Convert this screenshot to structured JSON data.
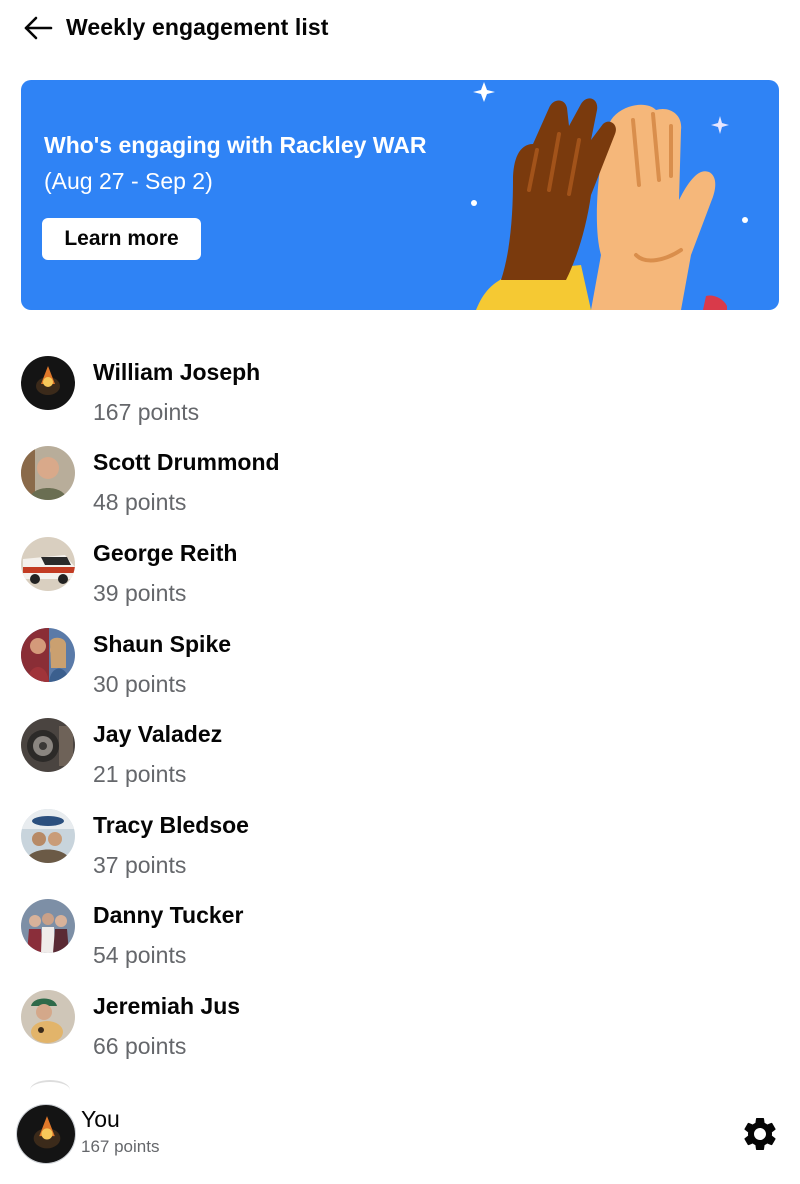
{
  "header": {
    "title": "Weekly engagement list",
    "back_icon": "arrow-left-icon"
  },
  "banner": {
    "title": "Who's engaging with Rackley WAR",
    "date_range": "(Aug 27 - Sep 2)",
    "learn_more_label": "Learn more",
    "background_color": "#2f83f5",
    "art": "high-five-hands-illustration"
  },
  "list": {
    "items": [
      {
        "name": "William Joseph",
        "points": "167 points"
      },
      {
        "name": "Scott Drummond",
        "points": "48 points"
      },
      {
        "name": "George Reith",
        "points": "39 points"
      },
      {
        "name": "Shaun Spike",
        "points": "30 points"
      },
      {
        "name": "Jay Valadez",
        "points": "21 points"
      },
      {
        "name": "Tracy Bledsoe",
        "points": "37 points"
      },
      {
        "name": "Danny Tucker",
        "points": "54 points"
      },
      {
        "name": "Jeremiah Jus",
        "points": "66 points"
      }
    ]
  },
  "footer": {
    "you_label": "You",
    "you_points": "167 points",
    "settings_icon": "gear-icon"
  },
  "colors": {
    "accent": "#2f83f5",
    "secondary_text": "#65676b",
    "primary_text": "#050505"
  }
}
